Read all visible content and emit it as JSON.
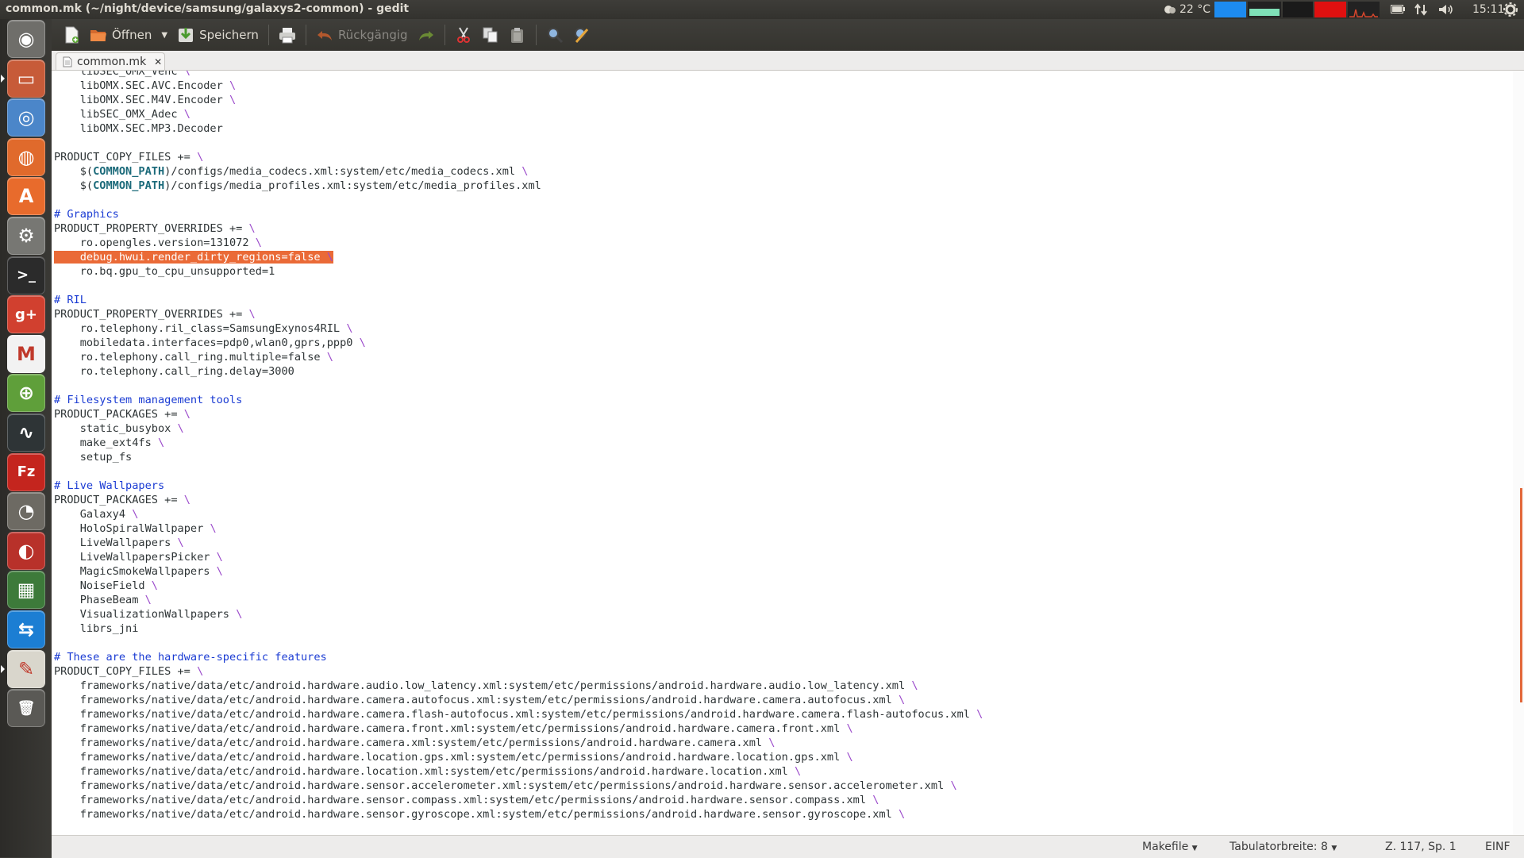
{
  "window": {
    "title": "common.mk (~/night/device/samsung/galaxys2-common) - gedit"
  },
  "panel": {
    "weather": "22 °C",
    "clock": "15:11"
  },
  "toolbar": {
    "open_label": "Öffnen",
    "save_label": "Speichern",
    "undo_label": "Rückgängig"
  },
  "tab": {
    "label": "common.mk",
    "close": "✕"
  },
  "editor": {
    "highlight_color": "#ea6a37",
    "comment_color": "#1a3bd3",
    "lines": [
      {
        "indent": true,
        "text": "libSEC_OMX_Venc",
        "bs": true
      },
      {
        "indent": true,
        "text": "libOMX.SEC.AVC.Encoder",
        "bs": true
      },
      {
        "indent": true,
        "text": "libOMX.SEC.M4V.Encoder",
        "bs": true
      },
      {
        "indent": true,
        "text": "libSEC_OMX_Adec",
        "bs": true
      },
      {
        "indent": true,
        "text": "libOMX.SEC.MP3.Decoder"
      },
      {
        "text": ""
      },
      {
        "text": "PRODUCT_COPY_FILES +=",
        "bs": true
      },
      {
        "indent": true,
        "pre": "$(",
        "kw": "COMMON_PATH",
        "text": ")/configs/media_codecs.xml:system/etc/media_codecs.xml",
        "bs": true
      },
      {
        "indent": true,
        "pre": "$(",
        "kw": "COMMON_PATH",
        "text": ")/configs/media_profiles.xml:system/etc/media_profiles.xml"
      },
      {
        "text": ""
      },
      {
        "comment": true,
        "text": "# Graphics"
      },
      {
        "text": "PRODUCT_PROPERTY_OVERRIDES +=",
        "bs": true
      },
      {
        "indent": true,
        "text": "ro.opengles.version=131072",
        "bs": true
      },
      {
        "indent": true,
        "text": "debug.hwui.render_dirty_regions=false",
        "bs": true,
        "hl": true
      },
      {
        "indent": true,
        "text": "ro.bq.gpu_to_cpu_unsupported=1"
      },
      {
        "text": ""
      },
      {
        "comment": true,
        "text": "# RIL"
      },
      {
        "text": "PRODUCT_PROPERTY_OVERRIDES +=",
        "bs": true
      },
      {
        "indent": true,
        "text": "ro.telephony.ril_class=SamsungExynos4RIL",
        "bs": true
      },
      {
        "indent": true,
        "text": "mobiledata.interfaces=pdp0,wlan0,gprs,ppp0",
        "bs": true
      },
      {
        "indent": true,
        "text": "ro.telephony.call_ring.multiple=false",
        "bs": true
      },
      {
        "indent": true,
        "text": "ro.telephony.call_ring.delay=3000"
      },
      {
        "text": ""
      },
      {
        "comment": true,
        "text": "# Filesystem management tools"
      },
      {
        "text": "PRODUCT_PACKAGES +=",
        "bs": true
      },
      {
        "indent": true,
        "text": "static_busybox",
        "bs": true
      },
      {
        "indent": true,
        "text": "make_ext4fs",
        "bs": true
      },
      {
        "indent": true,
        "text": "setup_fs"
      },
      {
        "text": ""
      },
      {
        "comment": true,
        "text": "# Live Wallpapers"
      },
      {
        "text": "PRODUCT_PACKAGES +=",
        "bs": true
      },
      {
        "indent": true,
        "text": "Galaxy4",
        "bs": true
      },
      {
        "indent": true,
        "text": "HoloSpiralWallpaper",
        "bs": true
      },
      {
        "indent": true,
        "text": "LiveWallpapers",
        "bs": true
      },
      {
        "indent": true,
        "text": "LiveWallpapersPicker",
        "bs": true
      },
      {
        "indent": true,
        "text": "MagicSmokeWallpapers",
        "bs": true
      },
      {
        "indent": true,
        "text": "NoiseField",
        "bs": true
      },
      {
        "indent": true,
        "text": "PhaseBeam",
        "bs": true
      },
      {
        "indent": true,
        "text": "VisualizationWallpapers",
        "bs": true
      },
      {
        "indent": true,
        "text": "librs_jni"
      },
      {
        "text": ""
      },
      {
        "comment": true,
        "text": "# These are the hardware-specific features"
      },
      {
        "text": "PRODUCT_COPY_FILES +=",
        "bs": true
      },
      {
        "indent": true,
        "text": "frameworks/native/data/etc/android.hardware.audio.low_latency.xml:system/etc/permissions/android.hardware.audio.low_latency.xml",
        "bs": true
      },
      {
        "indent": true,
        "text": "frameworks/native/data/etc/android.hardware.camera.autofocus.xml:system/etc/permissions/android.hardware.camera.autofocus.xml",
        "bs": true
      },
      {
        "indent": true,
        "text": "frameworks/native/data/etc/android.hardware.camera.flash-autofocus.xml:system/etc/permissions/android.hardware.camera.flash-autofocus.xml",
        "bs": true
      },
      {
        "indent": true,
        "text": "frameworks/native/data/etc/android.hardware.camera.front.xml:system/etc/permissions/android.hardware.camera.front.xml",
        "bs": true
      },
      {
        "indent": true,
        "text": "frameworks/native/data/etc/android.hardware.camera.xml:system/etc/permissions/android.hardware.camera.xml",
        "bs": true
      },
      {
        "indent": true,
        "text": "frameworks/native/data/etc/android.hardware.location.gps.xml:system/etc/permissions/android.hardware.location.gps.xml",
        "bs": true
      },
      {
        "indent": true,
        "text": "frameworks/native/data/etc/android.hardware.location.xml:system/etc/permissions/android.hardware.location.xml",
        "bs": true
      },
      {
        "indent": true,
        "text": "frameworks/native/data/etc/android.hardware.sensor.accelerometer.xml:system/etc/permissions/android.hardware.sensor.accelerometer.xml",
        "bs": true
      },
      {
        "indent": true,
        "text": "frameworks/native/data/etc/android.hardware.sensor.compass.xml:system/etc/permissions/android.hardware.sensor.compass.xml",
        "bs": true
      },
      {
        "indent": true,
        "text": "frameworks/native/data/etc/android.hardware.sensor.gyroscope.xml:system/etc/permissions/android.hardware.sensor.gyroscope.xml",
        "bs": true
      }
    ]
  },
  "statusbar": {
    "language": "Makefile",
    "tab_width": "Tabulatorbreite: 8",
    "position": "Z. 117, Sp. 1",
    "mode": "EINF"
  },
  "launcher": {
    "items": [
      {
        "name": "ubuntu-dash-icon",
        "color": "#6f6e6a",
        "glyph": "◉"
      },
      {
        "name": "files-icon",
        "color": "#c75b39",
        "glyph": "▭"
      },
      {
        "name": "chromium-icon",
        "color": "#4b86c9",
        "glyph": "◎"
      },
      {
        "name": "firefox-icon",
        "color": "#e06a2c",
        "glyph": "◍"
      },
      {
        "name": "software-center-icon",
        "color": "#e86b2c",
        "glyph": "A"
      },
      {
        "name": "system-settings-icon",
        "color": "#777773",
        "glyph": "⚙"
      },
      {
        "name": "terminal-icon",
        "color": "#2b2b2b",
        "glyph": ">_"
      },
      {
        "name": "google-plus-icon",
        "color": "#d1402f",
        "glyph": "g+"
      },
      {
        "name": "gmail-icon",
        "color": "#f2f2f2",
        "glyph": "M"
      },
      {
        "name": "arduino-icon",
        "color": "#5f9f3a",
        "glyph": "⊕"
      },
      {
        "name": "system-monitor-icon",
        "color": "#2e3436",
        "glyph": "∿"
      },
      {
        "name": "filezilla-icon",
        "color": "#c4251e",
        "glyph": "Fz"
      },
      {
        "name": "gimp-icon",
        "color": "#6d6a63",
        "glyph": "◔"
      },
      {
        "name": "brasero-icon",
        "color": "#b8312a",
        "glyph": "◐"
      },
      {
        "name": "rubik-game-icon",
        "color": "#3d7a3a",
        "glyph": "▦"
      },
      {
        "name": "teamviewer-icon",
        "color": "#1c7ed3",
        "glyph": "⇆"
      },
      {
        "name": "gedit-icon",
        "color": "#d9d6cc",
        "glyph": "✎"
      },
      {
        "name": "trash-icon",
        "color": "#5a5955",
        "glyph": "🗑"
      }
    ]
  }
}
